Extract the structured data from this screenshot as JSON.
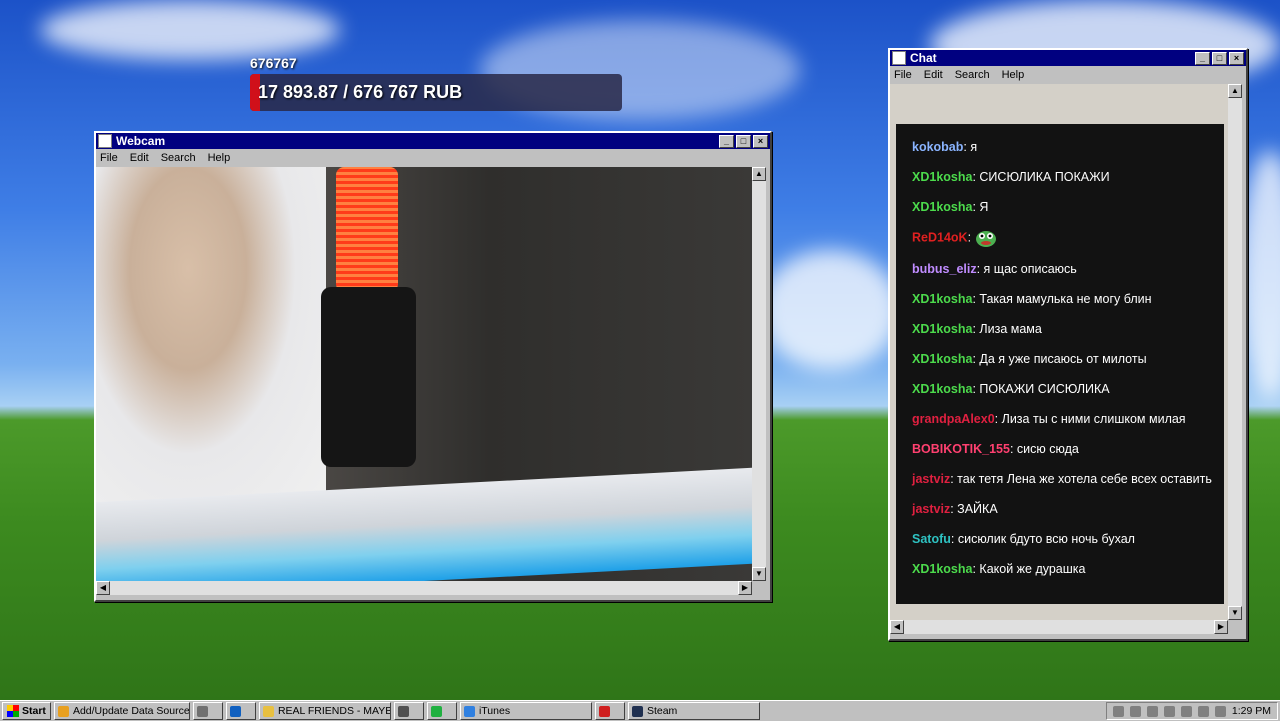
{
  "donation": {
    "name": "676767",
    "amount_text": "17 893.87 / 676 767 RUB",
    "progress_fraction": 0.026
  },
  "webcam_window": {
    "title": "Webcam",
    "menu": [
      "File",
      "Edit",
      "Search",
      "Help"
    ]
  },
  "chat_window": {
    "title": "Chat",
    "menu": [
      "File",
      "Edit",
      "Search",
      "Help"
    ],
    "messages": [
      {
        "user": "kokobab",
        "color": "#8ab4ff",
        "text": "я"
      },
      {
        "user": "XD1kosha",
        "color": "#4cdb4c",
        "text": "СИСЮЛИКА ПОКАЖИ"
      },
      {
        "user": "XD1kosha",
        "color": "#4cdb4c",
        "text": "Я"
      },
      {
        "user": "ReD14oK",
        "color": "#e02020",
        "text": "",
        "emote": "pepe-emote-icon"
      },
      {
        "user": "bubus_eliz",
        "color": "#c08cff",
        "text": "я щас описаюсь"
      },
      {
        "user": "XD1kosha",
        "color": "#4cdb4c",
        "text": "Такая мамулька не могу блин"
      },
      {
        "user": "XD1kosha",
        "color": "#4cdb4c",
        "text": "Лиза мама"
      },
      {
        "user": "XD1kosha",
        "color": "#4cdb4c",
        "text": "Да я уже писаюсь от милоты"
      },
      {
        "user": "XD1kosha",
        "color": "#4cdb4c",
        "text": "ПОКАЖИ СИСЮЛИКА"
      },
      {
        "user": "grandpaAlex0",
        "color": "#e02040",
        "text": "Лиза ты с ними слишком милая"
      },
      {
        "user": "BOBIKOTIK_155",
        "color": "#ff4070",
        "text": "сисю сюда"
      },
      {
        "user": "jastviz",
        "color": "#e02040",
        "text": "так тетя Лена же хотела себе всех оставить"
      },
      {
        "user": "jastviz",
        "color": "#e02040",
        "text": "ЗАЙКА"
      },
      {
        "user": "Satofu",
        "color": "#2ec2c2",
        "text": "сисюлик бдуто всю ночь бухал"
      },
      {
        "user": "XD1kosha",
        "color": "#4cdb4c",
        "text": "Какой же дурашка"
      }
    ]
  },
  "taskbar": {
    "start_label": "Start",
    "tasks": [
      {
        "label": "Add/Update Data Source...",
        "icon": "chrome-icon",
        "color": "#e8a020"
      },
      {
        "label": "",
        "icon": "explorer-icon",
        "color": "#707070"
      },
      {
        "label": "",
        "icon": "outlook-icon",
        "color": "#1060c0"
      },
      {
        "label": "REAL FRIENDS - MAYB...",
        "icon": "folder-icon",
        "color": "#e8c040"
      },
      {
        "label": "",
        "icon": "chevron-icon",
        "color": "#505050"
      },
      {
        "label": "",
        "icon": "spotify-icon",
        "color": "#20b040"
      },
      {
        "label": "iTunes",
        "icon": "itunes-icon",
        "color": "#3080e0"
      },
      {
        "label": "",
        "icon": "app-icon",
        "color": "#d02020"
      },
      {
        "label": "Steam",
        "icon": "steam-icon",
        "color": "#203050"
      }
    ],
    "clock": "1:29 PM"
  }
}
